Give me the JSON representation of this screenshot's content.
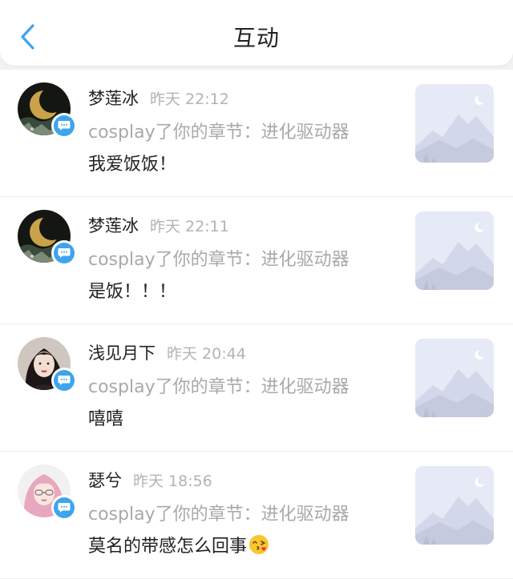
{
  "header": {
    "title": "互动",
    "back_label": "返回"
  },
  "colors": {
    "accent": "#3da4ee",
    "muted": "#a9a9a9",
    "text": "#222222"
  },
  "items": [
    {
      "user": "梦莲冰",
      "time": "昨天 22:12",
      "action": "cosplay了你的章节：进化驱动器",
      "comment": "我爱饭饭！",
      "avatar": "moon-night-avatar",
      "emoji": ""
    },
    {
      "user": "梦莲冰",
      "time": "昨天 22:11",
      "action": "cosplay了你的章节：进化驱动器",
      "comment": "是饭！！！",
      "avatar": "moon-night-avatar",
      "emoji": ""
    },
    {
      "user": "浅见月下",
      "time": "昨天 20:44",
      "action": "cosplay了你的章节：进化驱动器",
      "comment": "嘻嘻",
      "avatar": "girl-portrait-avatar",
      "emoji": ""
    },
    {
      "user": "瑟兮",
      "time": "昨天 18:56",
      "action": "cosplay了你的章节：进化驱动器",
      "comment": "莫名的带感怎么回事",
      "avatar": "pink-hair-avatar",
      "emoji": "kissing-face-emoji"
    }
  ]
}
